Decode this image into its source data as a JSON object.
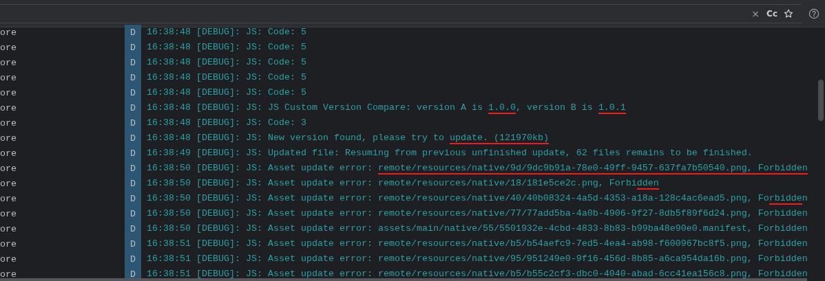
{
  "search": {
    "clear_label": "×",
    "match_case_label": "Cc"
  },
  "rows": [
    {
      "source": "ore",
      "level": "D",
      "segments": [
        {
          "text": "16:38:48 [DEBUG]: JS: Code: 5",
          "marked": false
        }
      ]
    },
    {
      "source": "ore",
      "level": "D",
      "segments": [
        {
          "text": "16:38:48 [DEBUG]: JS: Code: 5",
          "marked": false
        }
      ]
    },
    {
      "source": "ore",
      "level": "D",
      "segments": [
        {
          "text": "16:38:48 [DEBUG]: JS: Code: 5",
          "marked": false
        }
      ]
    },
    {
      "source": "ore",
      "level": "D",
      "segments": [
        {
          "text": "16:38:48 [DEBUG]: JS: Code: 5",
          "marked": false
        }
      ]
    },
    {
      "source": "ore",
      "level": "D",
      "segments": [
        {
          "text": "16:38:48 [DEBUG]: JS: Code: 5",
          "marked": false
        }
      ]
    },
    {
      "source": "ore",
      "level": "D",
      "segments": [
        {
          "text": "16:38:48 [DEBUG]: JS: JS Custom Version Compare: version A is ",
          "marked": false
        },
        {
          "text": "1.0.0",
          "marked": true
        },
        {
          "text": ", version B is ",
          "marked": false
        },
        {
          "text": "1.0.1",
          "marked": true
        }
      ]
    },
    {
      "source": "ore",
      "level": "D",
      "segments": [
        {
          "text": "16:38:48 [DEBUG]: JS: Code: 3",
          "marked": false
        }
      ]
    },
    {
      "source": "ore",
      "level": "D",
      "segments": [
        {
          "text": "16:38:48 [DEBUG]: JS: New version found, please try to ",
          "marked": false
        },
        {
          "text": "update. (121970kb)",
          "marked": true
        }
      ]
    },
    {
      "source": "ore",
      "level": "D",
      "segments": [
        {
          "text": "16:38:49 [DEBUG]: JS: Updated file: Resuming from previous unfinished update, 62 files remains to be finished.",
          "marked": false
        }
      ]
    },
    {
      "source": "ore",
      "level": "D",
      "segments": [
        {
          "text": "16:38:50 [DEBUG]: JS: Asset update error: ",
          "marked": false
        },
        {
          "text": "remote/resources/native/9d/9dc9b91a-78e0-49ff-9457-637fa7b50540.png, Forbidden",
          "marked": true
        }
      ]
    },
    {
      "source": "ore",
      "level": "D",
      "segments": [
        {
          "text": "16:38:50 [DEBUG]: JS: Asset update error: remote/resources/native/18/181e5ce2c.png, Forbi",
          "marked": false
        },
        {
          "text": "dden",
          "marked": true
        }
      ]
    },
    {
      "source": "ore",
      "level": "D",
      "segments": [
        {
          "text": "16:38:50 [DEBUG]: JS: Asset update error: remote/resources/native/40/40b08324-4a5d-4353-a18a-128c4ac6ead5.png, Fo",
          "marked": false
        },
        {
          "text": "rbidde",
          "marked": true
        },
        {
          "text": "n",
          "marked": false
        }
      ]
    },
    {
      "source": "ore",
      "level": "D",
      "segments": [
        {
          "text": "16:38:50 [DEBUG]: JS: Asset update error: remote/resources/native/77/77add5ba-4a0b-4906-9f27-8db5f89f6d24.png, Forbidden",
          "marked": false
        }
      ]
    },
    {
      "source": "ore",
      "level": "D",
      "segments": [
        {
          "text": "16:38:50 [DEBUG]: JS: Asset update error: assets/main/native/55/5501932e-4cbd-4833-8b83-b99ba48e90e0.manifest, Forbidden",
          "marked": false
        }
      ]
    },
    {
      "source": "ore",
      "level": "D",
      "segments": [
        {
          "text": "16:38:51 [DEBUG]: JS: Asset update error: remote/resources/native/b5/b54aefc9-7ed5-4ea4-ab98-f600967bc8f5.png, Forbidden",
          "marked": false
        }
      ]
    },
    {
      "source": "ore",
      "level": "D",
      "segments": [
        {
          "text": "16:38:51 [DEBUG]: JS: Asset update error: remote/resources/native/95/951249e0-9f16-456d-8b85-a6ca954da16b.png, Forbidden",
          "marked": false
        }
      ]
    },
    {
      "source": "ore",
      "level": "D",
      "segments": [
        {
          "text": "16:38:51 [DEBUG]: JS: Asset update error: remote/resources/native/b5/b55c2cf3-dbc0-4040-abad-6cc41ea156c8.png, Forbidden",
          "marked": false
        }
      ]
    }
  ]
}
